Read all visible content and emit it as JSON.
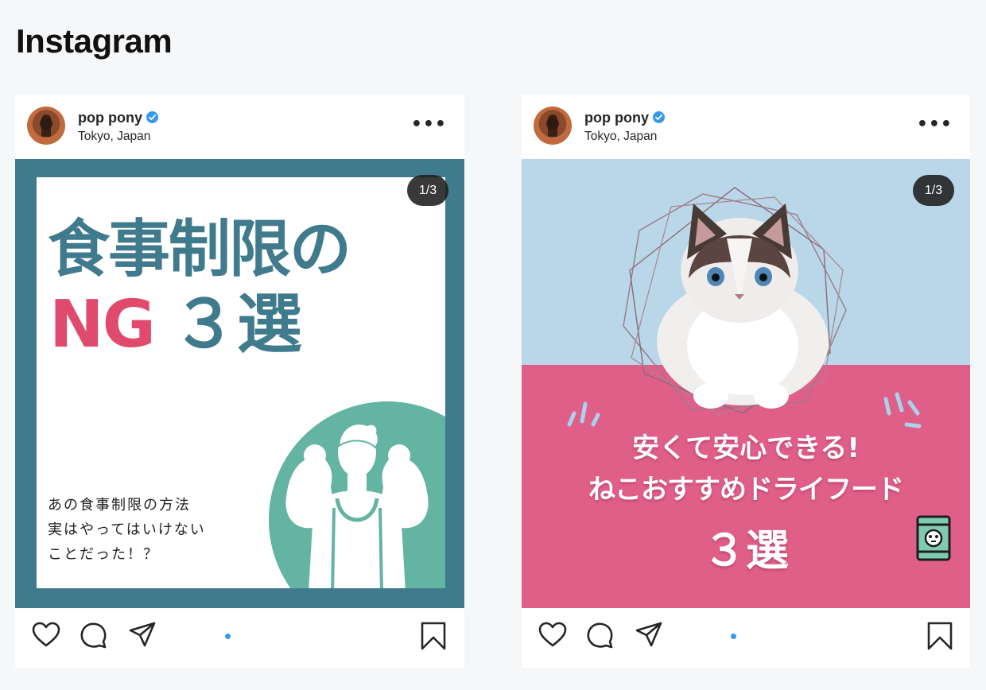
{
  "page": {
    "title": "Instagram"
  },
  "posts": [
    {
      "username": "pop pony",
      "location": "Tokyo, Japan",
      "more": "•••",
      "counter": "1/3",
      "creative": {
        "headline_line1": "食事制限の",
        "headline_ng": "NG",
        "headline_rest": "３選",
        "subtext": [
          "あの食事制限の方法",
          "実はやってはいけない",
          "ことだった！？"
        ],
        "colors": {
          "frame": "#407a8d",
          "accent": "#e04a6d",
          "circle": "#63b4a3"
        }
      },
      "actions": [
        "heart-icon",
        "comment-icon",
        "share-icon",
        "bookmark-icon"
      ],
      "carousel_dots": 1
    },
    {
      "username": "pop pony",
      "location": "Tokyo, Japan",
      "more": "•••",
      "counter": "1/3",
      "creative": {
        "line1": "安くて安心できる!",
        "line2": "ねこおすすめドライフード",
        "line3": "３選",
        "colors": {
          "sky": "#b9d7e8",
          "pink": "#e05f89"
        }
      },
      "actions": [
        "heart-icon",
        "comment-icon",
        "share-icon",
        "bookmark-icon"
      ],
      "carousel_dots": 1
    }
  ],
  "colors": {
    "verified": "#3897f0",
    "background": "#f6f7f9"
  }
}
